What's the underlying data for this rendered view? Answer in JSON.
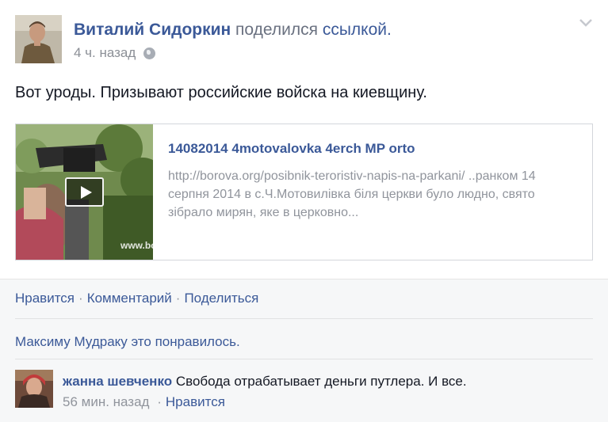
{
  "post": {
    "author": "Виталий Сидоркин",
    "action_text": "поделился",
    "action_link": "ссылкой.",
    "timestamp": "4 ч. назад",
    "privacy_icon": "globe-icon",
    "menu_icon": "chevron-down-icon",
    "text": "Вот уроды. Призывают российские войска на киевщину."
  },
  "link_card": {
    "title": "14082014 4motovalovka 4erch MP orto",
    "description": "http://borova.org/posibnik-teroristiv-napis-na-parkani/ ..ранком 14 серпня 2014 в с.Ч.Мотовилівка біля церкви було людно, свято зібрало мирян, яке в церковно...",
    "thumbnail_watermark": "www.bo",
    "play_icon": "play-icon"
  },
  "actions": {
    "like": "Нравится",
    "separator": "·",
    "comment": "Комментарий",
    "share": "Поделиться"
  },
  "likes_text": "Максиму Мудраку это понравилось.",
  "comment": {
    "author": "жанна шевченко",
    "text": "Свобода отрабатывает деньги путлера. И все.",
    "time": "56 мин. назад",
    "separator": "·",
    "like": "Нравится"
  },
  "colors": {
    "link": "#3b5998",
    "muted": "#90949c",
    "text": "#141823",
    "footer_bg": "#f6f7f8"
  }
}
